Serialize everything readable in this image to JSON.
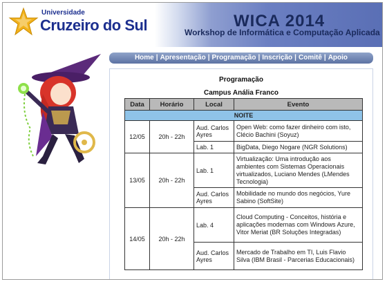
{
  "header": {
    "university_small": "Universidade",
    "university_big": "Cruzeiro do Sul",
    "event_title": "WICA 2014",
    "event_subtitle": "Workshop de Informática e Computação Aplicada",
    "colors": {
      "brand_blue": "#1c2f8f",
      "banner_blue": "#5a6fb5",
      "star_gold": "#f2b21b"
    }
  },
  "nav": {
    "items": [
      {
        "label": "Home"
      },
      {
        "label": "Apresentação"
      },
      {
        "label": "Programação"
      },
      {
        "label": "Inscrição"
      },
      {
        "label": "Comitê"
      },
      {
        "label": "Apoio"
      }
    ],
    "separator": "|"
  },
  "mascot": {
    "icon": "witch-mascot-icon"
  },
  "main": {
    "title": "Programação",
    "campus": "Campus Anália Franco",
    "table": {
      "headers": [
        "Data",
        "Horário",
        "Local",
        "Evento"
      ],
      "section": "NOITE",
      "days": [
        {
          "date": "12/05",
          "time": "20h - 22h",
          "sessions": [
            {
              "local": "Aud. Carlos Ayres",
              "event": "Open Web: como fazer dinheiro com isto, Clécio Bachini (Soyuz)"
            },
            {
              "local": "Lab. 1",
              "event": "BigData, Diego Nogare (NGR Solutions)"
            }
          ]
        },
        {
          "date": "13/05",
          "time": "20h - 22h",
          "sessions": [
            {
              "local": "Lab. 1",
              "event": "Virtualização: Uma introdução aos ambientes com Sistemas Operacionais virtualizados, Luciano Mendes (LMendes Tecnologia)"
            },
            {
              "local": "Aud. Carlos Ayres",
              "event": "Mobilidade no mundo dos negócios, Yure Sabino (SoftSite)"
            }
          ]
        },
        {
          "date": "14/05",
          "time": "20h - 22h",
          "sessions": [
            {
              "local": "Lab. 4",
              "event": "Cloud Computing - Conceitos, história e aplicações modernas com Windows Azure, Vitor Meriat (BR Soluções Integradas)"
            },
            {
              "local": "Aud. Carlos Ayres",
              "event": "Mercado de Trabalho em TI, Luis Flavio Silva (IBM Brasil - Parcerias Educacionais)"
            }
          ]
        }
      ]
    }
  }
}
